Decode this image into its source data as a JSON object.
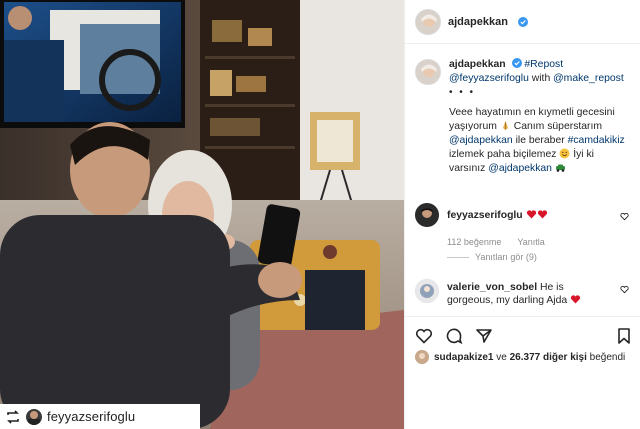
{
  "post": {
    "author": "ajdapekkan",
    "photo_repost_credit": "feyyazserifoglu"
  },
  "caption": {
    "username": "ajdapekkan",
    "hashtag_repost": "#Repost",
    "repost_user": "@feyyazserifoglu",
    "with_text": " with ",
    "make_repost": "@make_repost",
    "dots": "• • •",
    "line1": "Veee hayatımın en kıymetli gecesini yaşıyorum",
    "line2": " Canım süperstarım",
    "mention_ajda": "@ajdapekkan",
    "line3": " ile beraber ",
    "hashtag_cam": "#camdakikiz",
    "line4": " izlemek paha biçilemez",
    "line5": " İyi ki varsınız ",
    "mention_ajda2": "@ajdapekkan"
  },
  "comments": [
    {
      "username": "feyyazserifoglu",
      "text": "",
      "likes_label": "112 beğenme",
      "reply_label": "Yanıtla",
      "view_replies": "Yanıtları gör (9)"
    },
    {
      "username": "valerie_von_sobel",
      "text": " He is gorgeous, my darling Ajda"
    }
  ],
  "likes": {
    "first_user": "sudapakize1",
    "middle": " ve ",
    "count": "26.377 diğer kişi",
    "suffix": " beğendi"
  },
  "colors": {
    "verified_blue": "#3897f0",
    "heart_red": "#ed4956",
    "link_blue": "#00376b",
    "muted": "#8e8e8e"
  },
  "icons": [
    "verified-icon",
    "pray-emoji",
    "smile-emoji",
    "car-emoji",
    "heart-emoji",
    "heart-outline-icon",
    "comment-icon",
    "share-icon",
    "bookmark-icon",
    "repost-icon"
  ]
}
